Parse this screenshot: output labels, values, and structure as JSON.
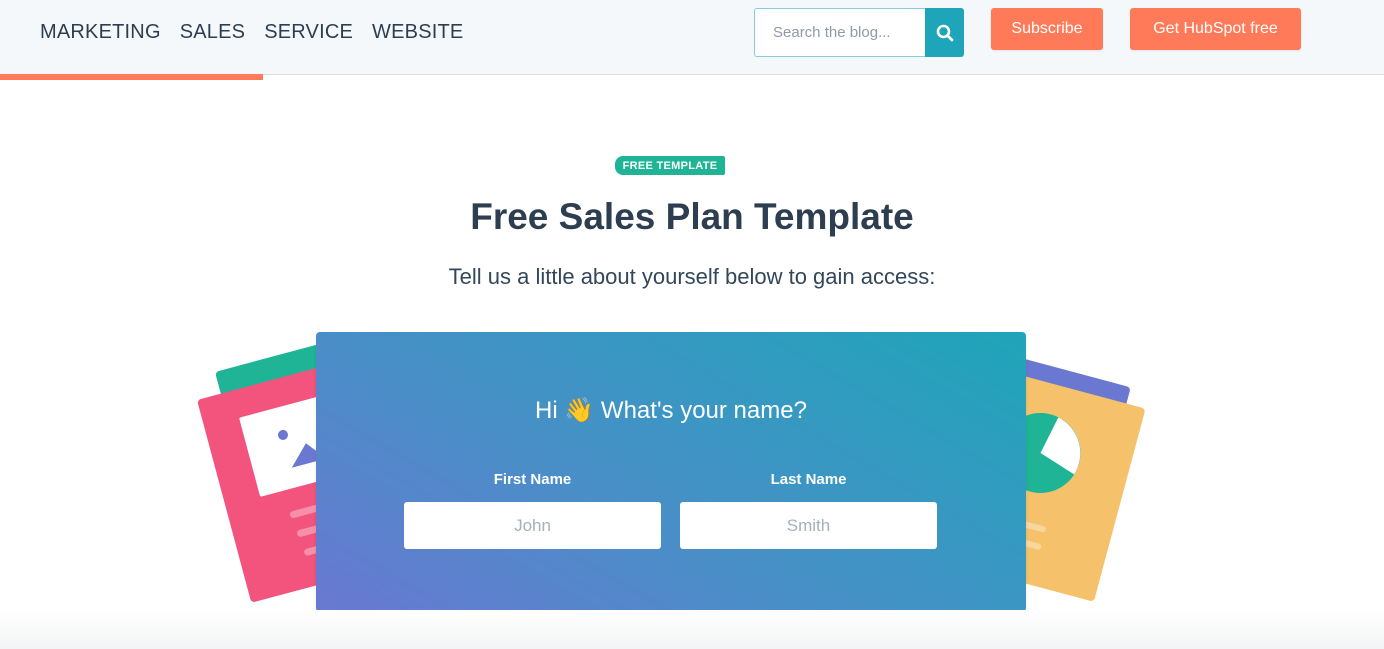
{
  "header": {
    "nav": [
      {
        "label": "MARKETING"
      },
      {
        "label": "SALES"
      },
      {
        "label": "SERVICE"
      },
      {
        "label": "WEBSITE"
      }
    ],
    "search": {
      "placeholder": "Search the blog...",
      "value": "",
      "icon": "search-icon"
    },
    "subscribe_label": "Subscribe",
    "get_hubspot_label": "Get HubSpot free",
    "reading_progress": 0.19
  },
  "hero": {
    "badge": "FREE TEMPLATE",
    "title": "Free Sales Plan Template",
    "subtitle": "Tell us a little about yourself below to gain access:"
  },
  "form": {
    "greeting": "Hi 👋 What's your name?",
    "fields": [
      {
        "label": "First Name",
        "placeholder": "John",
        "value": ""
      },
      {
        "label": "Last Name",
        "placeholder": "Smith",
        "value": ""
      }
    ]
  },
  "colors": {
    "accent_orange": "#ff7a59",
    "teal": "#1fa5b9",
    "green_badge": "#1fb495",
    "heading": "#2d3e50",
    "pink_card": "#f2547d",
    "yellow_card": "#f5c26b",
    "purple_card": "#6a78d1"
  }
}
